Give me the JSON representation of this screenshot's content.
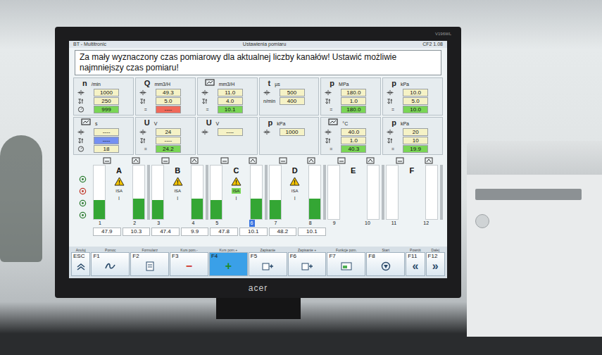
{
  "scene": {
    "monitor_brand": "acer",
    "monitor_model": "V196WL"
  },
  "window": {
    "title": "BT - Multitronic",
    "subtitle": "Ustawienia pomiaru",
    "version": "CF2 1.08"
  },
  "message": "Za mały wyznaczony czas pomiarowy dla aktualnej liczby kanałów! Ustawić możliwie najmniejszy czas pomiaru!",
  "params": [
    {
      "symbol": "n",
      "unit": "/min",
      "rows": [
        {
          "kind": "max",
          "label": "",
          "value": "1000",
          "color": "#f5f2c6"
        },
        {
          "kind": "min",
          "label": "",
          "value": "250",
          "color": "#f5f2c6"
        },
        {
          "kind": "actual",
          "label": "",
          "value": "999",
          "color": "#7ad656"
        }
      ]
    },
    {
      "symbol": "Q",
      "unit": "mm3/H",
      "rows": [
        {
          "kind": "max",
          "label": "",
          "value": "49.3",
          "color": "#f5f2c6"
        },
        {
          "kind": "min",
          "label": "",
          "value": "5.0",
          "color": "#f5f2c6"
        },
        {
          "kind": "actual",
          "label": "=",
          "value": "----",
          "color": "#f0695a"
        }
      ]
    },
    {
      "symbol": "",
      "unit": "mm3/H",
      "rows": [
        {
          "kind": "max",
          "label": "",
          "value": "11.0",
          "color": "#f5f2c6"
        },
        {
          "kind": "min",
          "label": "",
          "value": "4.0",
          "color": "#f5f2c6"
        },
        {
          "kind": "actual",
          "label": "=",
          "value": "10.1",
          "color": "#7ad656"
        }
      ]
    },
    {
      "symbol": "t",
      "unit": "µs",
      "rows": [
        {
          "kind": "max",
          "label": "",
          "value": "500",
          "color": "#f5f2c6"
        },
        {
          "kind": "min",
          "label": "n/min",
          "value": "400",
          "color": "#f5f2c6"
        }
      ]
    },
    {
      "symbol": "p",
      "unit": "MPa",
      "rows": [
        {
          "kind": "max",
          "label": "",
          "value": "180.0",
          "color": "#f5f2c6"
        },
        {
          "kind": "min",
          "label": "",
          "value": "1.0",
          "color": "#f5f2c6"
        },
        {
          "kind": "actual",
          "label": "=",
          "value": "180.0",
          "color": "#7ad656"
        }
      ]
    },
    {
      "symbol": "p",
      "unit": "kPa",
      "rows": [
        {
          "kind": "max",
          "label": "",
          "value": "10.0",
          "color": "#f5f2c6"
        },
        {
          "kind": "min",
          "label": "",
          "value": "5.0",
          "color": "#f5f2c6"
        },
        {
          "kind": "actual",
          "label": "=",
          "value": "10.0",
          "color": "#7ad656"
        }
      ]
    },
    {
      "symbol": "",
      "unit": "s",
      "rows": [
        {
          "kind": "max",
          "label": "",
          "value": "----",
          "color": "#f5f2c6"
        },
        {
          "kind": "min",
          "label": "",
          "value": "----",
          "color": "#7590f2"
        },
        {
          "kind": "actual",
          "label": "",
          "value": "18",
          "color": "#f5f2c6"
        }
      ]
    },
    {
      "symbol": "U",
      "unit": "V",
      "rows": [
        {
          "kind": "max",
          "label": "",
          "value": "24",
          "color": "#f5f2c6"
        },
        {
          "kind": "min",
          "label": "",
          "value": "----",
          "color": "#f5f2c6"
        },
        {
          "kind": "actual",
          "label": "=",
          "value": "24.2",
          "color": "#7ad656"
        }
      ]
    },
    {
      "symbol": "U",
      "unit": "V",
      "rows": [
        {
          "kind": "max",
          "label": "",
          "value": "----",
          "color": "#f5f2c6"
        }
      ]
    },
    {
      "symbol": "p",
      "unit": "kPa",
      "rows": [
        {
          "kind": "max",
          "label": "",
          "value": "1000",
          "color": "#f5f2c6"
        }
      ]
    },
    {
      "symbol": "",
      "unit": "°C",
      "rows": [
        {
          "kind": "max",
          "label": "",
          "value": "40.0",
          "color": "#f5f2c6"
        },
        {
          "kind": "min",
          "label": "",
          "value": "1.0",
          "color": "#f5f2c6"
        },
        {
          "kind": "actual",
          "label": "=",
          "value": "40.3",
          "color": "#7ad656"
        }
      ]
    },
    {
      "symbol": "p",
      "unit": "kPa",
      "rows": [
        {
          "kind": "max",
          "label": "",
          "value": "20",
          "color": "#f5f2c6"
        },
        {
          "kind": "min",
          "label": "",
          "value": "10",
          "color": "#f5f2c6"
        },
        {
          "kind": "actual",
          "label": "=",
          "value": "19.9",
          "color": "#7ad656"
        }
      ]
    }
  ],
  "channel_groups": [
    {
      "letter": "A",
      "warning": true,
      "isa": "ISA",
      "isa_active": false,
      "marker": "I",
      "channels": [
        {
          "number": "1",
          "level": 0.36,
          "selected": false,
          "reading": "47.9"
        },
        {
          "number": "2",
          "level": 0.38,
          "selected": false,
          "reading": "10.3"
        }
      ]
    },
    {
      "letter": "B",
      "warning": true,
      "isa": "ISA",
      "isa_active": false,
      "marker": "I",
      "channels": [
        {
          "number": "3",
          "level": 0.36,
          "selected": false,
          "reading": "47.4"
        },
        {
          "number": "4",
          "level": 0.38,
          "selected": false,
          "reading": "9.9"
        }
      ]
    },
    {
      "letter": "C",
      "warning": true,
      "isa": "ISA",
      "isa_active": true,
      "marker": "I",
      "channels": [
        {
          "number": "5",
          "level": 0.36,
          "selected": false,
          "reading": "47.8"
        },
        {
          "number": "6",
          "level": 0.38,
          "selected": true,
          "reading": "10.1"
        }
      ]
    },
    {
      "letter": "D",
      "warning": true,
      "isa": "ISA",
      "isa_active": false,
      "marker": "I",
      "channels": [
        {
          "number": "7",
          "level": 0.36,
          "selected": false,
          "reading": "48.2"
        },
        {
          "number": "8",
          "level": 0.38,
          "selected": false,
          "reading": "10.1"
        }
      ]
    },
    {
      "letter": "E",
      "warning": false,
      "isa": "",
      "isa_active": false,
      "marker": "",
      "channels": [
        {
          "number": "9",
          "level": 0,
          "selected": false,
          "reading": ""
        },
        {
          "number": "10",
          "level": 0,
          "selected": false,
          "reading": ""
        }
      ]
    },
    {
      "letter": "F",
      "warning": false,
      "isa": "",
      "isa_active": false,
      "marker": "",
      "channels": [
        {
          "number": "11",
          "level": 0,
          "selected": false,
          "reading": ""
        },
        {
          "number": "12",
          "level": 0,
          "selected": false,
          "reading": ""
        }
      ]
    }
  ],
  "function_keys": [
    {
      "key": "ESC",
      "label": "Anuluj",
      "glyph": "",
      "color": "#2a4a6a",
      "selected": false
    },
    {
      "key": "F1",
      "label": "Pomoc",
      "glyph": "",
      "color": "#2a4a6a",
      "selected": false
    },
    {
      "key": "F2",
      "label": "Formularz",
      "glyph": "",
      "color": "#2a4a6a",
      "selected": false
    },
    {
      "key": "F3",
      "label": "Kurs pom.-",
      "glyph": "−",
      "color": "#d0342c",
      "selected": false
    },
    {
      "key": "F4",
      "label": "Kurs pom.+",
      "glyph": "+",
      "color": "#1f8a2a",
      "selected": true
    },
    {
      "key": "F5",
      "label": "Zapisanie",
      "glyph": "",
      "color": "#2a4a6a",
      "selected": false
    },
    {
      "key": "F6",
      "label": "Zapisanie +",
      "glyph": "",
      "color": "#2a4a6a",
      "selected": false
    },
    {
      "key": "F7",
      "label": "Funkcje pom.",
      "glyph": "",
      "color": "#2a4a6a",
      "selected": false
    },
    {
      "key": "F8",
      "label": "Start",
      "glyph": "",
      "color": "#2a4a6a",
      "selected": false
    },
    {
      "key": "F11",
      "label": "Powrót",
      "glyph": "«",
      "color": "#2a4a6a",
      "selected": false
    },
    {
      "key": "F12",
      "label": "Dalej",
      "glyph": "»",
      "color": "#2a4a6a",
      "selected": false
    }
  ]
}
